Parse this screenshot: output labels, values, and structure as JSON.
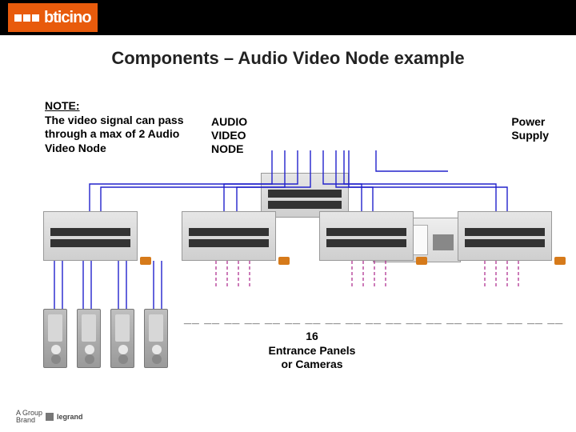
{
  "header": {
    "brand_text": "bticino"
  },
  "title": "Components – Audio Video Node example",
  "note": {
    "heading": "NOTE:",
    "body": "The video signal can pass through a max of 2 Audio Video Node"
  },
  "labels": {
    "audio_video_node": "AUDIO\nVIDEO\nNODE",
    "power_supply": "Power\nSupply"
  },
  "placeholder": {
    "dashes": "__ __ __ __ __ __ __ __ __ __ __ __ __ __ __ __ __ __ __",
    "count": "16",
    "text": "Entrance Panels\nor Cameras"
  },
  "footer": {
    "group_line1": "A Group",
    "group_line2": "Brand",
    "legrand": "legrand"
  },
  "colors": {
    "brand": "#e85b0c",
    "wire": "#2222cc",
    "wire_dash": "#aa2288"
  },
  "diagram": {
    "top_devices": [
      "audio-video-node",
      "power-supply"
    ],
    "mid_nodes": 4,
    "bottom_panels": 4,
    "placeholder_panels": 16
  }
}
